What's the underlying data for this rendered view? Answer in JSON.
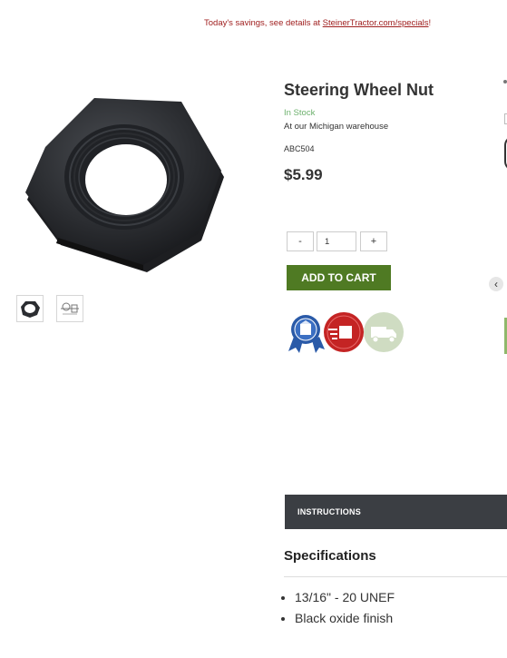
{
  "promo": {
    "text": "Today's savings, see details at ",
    "link": "SteinerTractor.com/specials",
    "suffix": "!"
  },
  "product": {
    "title": "Steering Wheel Nut",
    "stock": "In Stock",
    "warehouse": "At our Michigan warehouse",
    "sku": "ABC504",
    "price": "$5.99",
    "image_icon": "hex-nut-image"
  },
  "gallery": {
    "thumbnails": [
      "hex-nut-thumbnail",
      "diagram-thumbnail"
    ]
  },
  "quantity": {
    "minus_label": "-",
    "value": "1",
    "plus_label": "+"
  },
  "cart": {
    "add_label": "ADD TO CART"
  },
  "badges": [
    {
      "icon": "quality-ribbon-badge-icon",
      "color": "#2a5aa8"
    },
    {
      "icon": "fast-shipping-badge-icon",
      "color": "#c42424"
    },
    {
      "icon": "delivery-truck-badge-icon",
      "color": "#cfdcc2"
    }
  ],
  "colors": {
    "accent": "#4f7a23",
    "promo": "#a02020",
    "stock": "#6db16d",
    "tab_bar": "#3b3e43"
  },
  "carousel": {
    "prev_label": "‹"
  },
  "tabs": {
    "instructions": "INSTRUCTIONS"
  },
  "specifications": {
    "title": "Specifications",
    "items": [
      "13/16\" - 20 UNEF",
      "Black oxide finish"
    ]
  }
}
